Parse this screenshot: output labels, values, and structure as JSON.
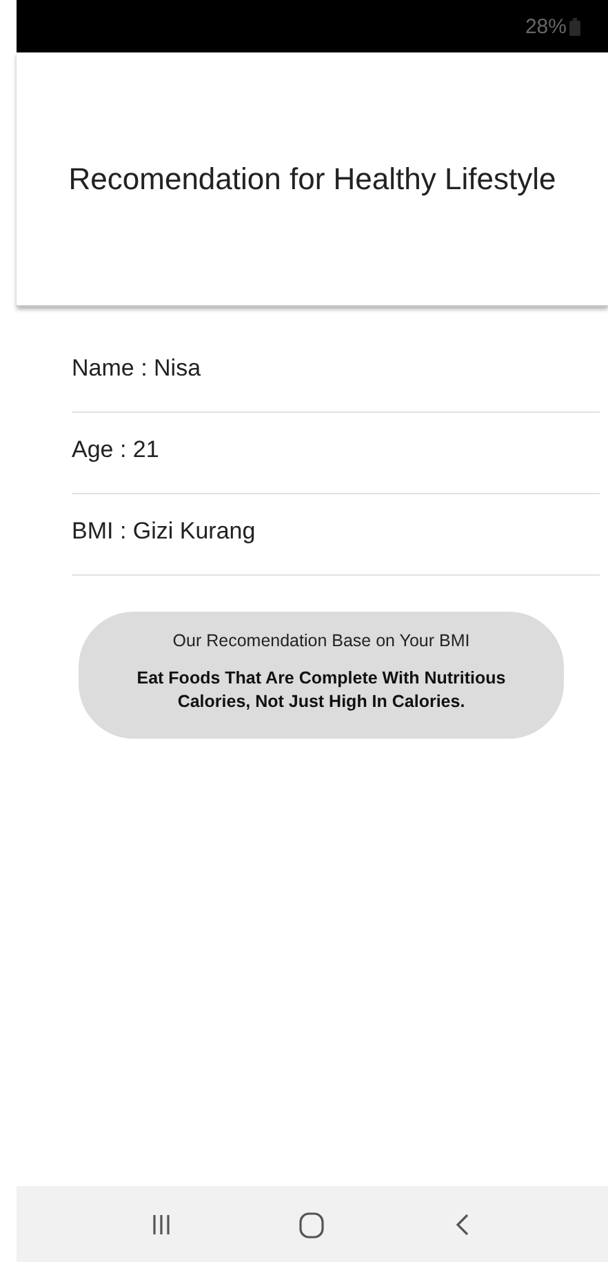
{
  "status_bar": {
    "battery": "28%"
  },
  "header": {
    "title": "Recomendation for Healthy Lifestyle"
  },
  "info_rows": [
    "Name : Nisa",
    "Age : 21",
    "BMI : Gizi Kurang"
  ],
  "recommendation": {
    "heading": "Our Recomendation Base on Your BMI",
    "text": "Eat Foods That Are Complete With Nutritious Calories, Not Just High In Calories."
  }
}
